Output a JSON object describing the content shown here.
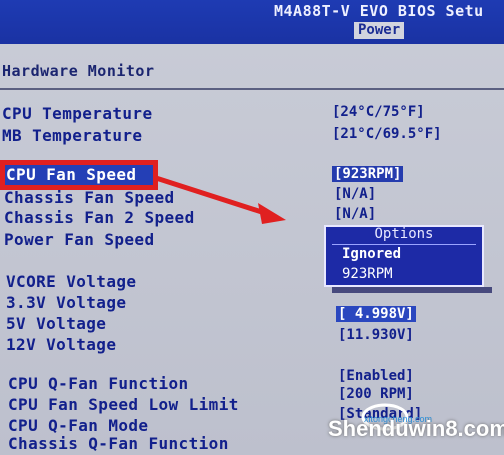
{
  "header": {
    "bios_title": "M4A88T-V EVO BIOS Setu",
    "active_tab": "Power"
  },
  "section": {
    "title": "Hardware Monitor"
  },
  "rows": [
    {
      "label": "CPU Temperature",
      "value": "[24°C/75°F]"
    },
    {
      "label": "MB Temperature",
      "value": "[21°C/69.5°F]"
    },
    {
      "label": "CPU Fan Speed",
      "value": "[923RPM]"
    },
    {
      "label": "Chassis Fan Speed",
      "value": "[N/A]"
    },
    {
      "label": "Chassis Fan 2 Speed",
      "value": "[N/A]"
    },
    {
      "label": "Power Fan Speed",
      "value": ""
    },
    {
      "label": "VCORE  Voltage",
      "value": ""
    },
    {
      "label": "3.3V  Voltage",
      "value": ""
    },
    {
      "label": "5V  Voltage",
      "value": "[ 4.998V]"
    },
    {
      "label": "12V  Voltage",
      "value": "[11.930V]"
    },
    {
      "label": "CPU Q-Fan Function",
      "value": "[Enabled]"
    },
    {
      "label": "CPU Fan Speed Low Limit",
      "value": "[200 RPM]"
    },
    {
      "label": "CPU Q-Fan Mode",
      "value": "[Standard]"
    },
    {
      "label": "Chassis Q-Fan Function",
      "value": ""
    }
  ],
  "options_popup": {
    "title": "Options",
    "items": [
      "Ignored",
      "923RPM"
    ]
  },
  "watermark": {
    "text": "Shenduwin8.com",
    "subtext": "xitongcheng.com"
  },
  "colors": {
    "header_blue": "#1e3bb3",
    "panel_gray": "#c4c7d3",
    "label_blue": "#12208c",
    "highlight_red": "#e02020",
    "popup_blue": "#1d2aa6"
  },
  "icons": {
    "annotation_arrow": "red-arrow-icon"
  }
}
